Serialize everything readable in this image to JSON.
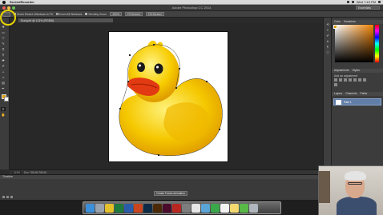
{
  "menubar": {
    "app_name": "ScreenRecorder",
    "clock": "Wed 7:43 PM"
  },
  "window": {
    "title": "Adobe Photoshop CC 2014",
    "workspace": "Essentials"
  },
  "options": {
    "items": [
      {
        "label": "Zoom Resize Windows to Fit",
        "checked": true
      },
      {
        "label": "Zoom All Windows",
        "checked": false
      },
      {
        "label": "Scrubby Zoom",
        "checked": true
      }
    ],
    "buttons": [
      "100%",
      "Fit Screen",
      "Fill Screen"
    ]
  },
  "document": {
    "tab_label": "Ducky.tif @ 113% (RGB/8)"
  },
  "status": {
    "zoom": "113%",
    "doc_size": "Doc: 785.6K/785.6K"
  },
  "timeline": {
    "title": "Timeline",
    "create_button": "Create Frame Animation"
  },
  "panels": {
    "color_tabs": [
      "Color",
      "Swatches"
    ],
    "adjust_tabs": [
      "Adjustments",
      "Styles"
    ],
    "adjust_title": "Add an adjustment",
    "layer_tabs": [
      "Layers",
      "Channels",
      "Paths"
    ],
    "path_name": "Path 1"
  },
  "colors": {
    "foreground": "#e0a000",
    "background": "#ffffff",
    "highlight": "#e8d400"
  },
  "dock": {
    "apps": [
      "finder",
      "launchpad",
      "chrome",
      "excel",
      "word",
      "powerpoint",
      "photoshop",
      "illustrator",
      "indesign",
      "filezilla",
      "system-preferences",
      "screenrecorder",
      "preview",
      "facetime",
      "calendar",
      "notes",
      "messages",
      "trash"
    ]
  }
}
